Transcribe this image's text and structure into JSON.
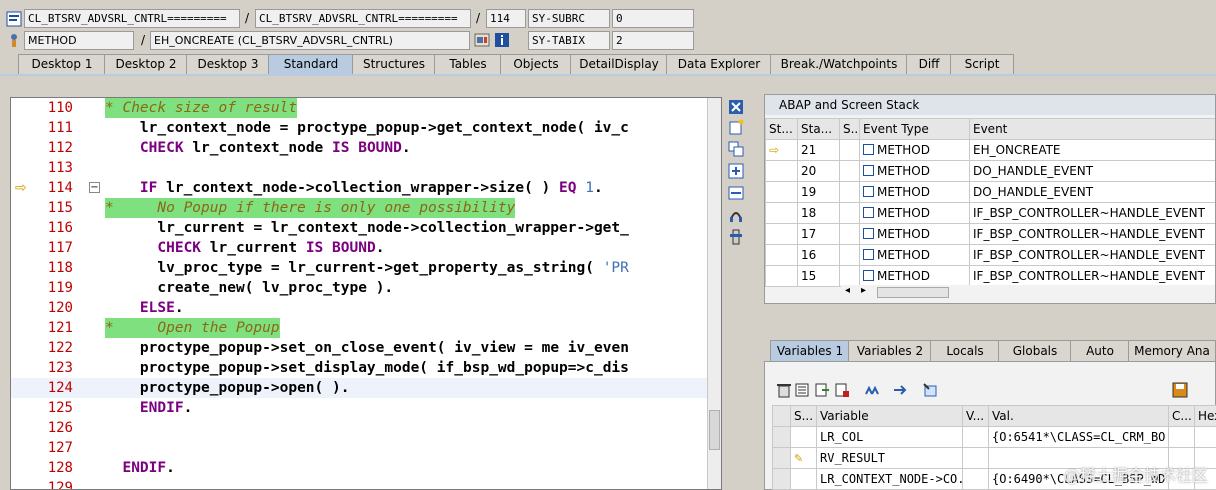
{
  "header": {
    "program1": "CL_BTSRV_ADVSRL_CNTRL=========",
    "program2": "CL_BTSRV_ADVSRL_CNTRL=========",
    "line_no": "114",
    "sy_subrc_label": "SY-SUBRC",
    "sy_subrc_value": "0",
    "kind": "METHOD",
    "event_name": "EH_ONCREATE (CL_BTSRV_ADVSRL_CNTRL)",
    "sy_tabix_label": "SY-TABIX",
    "sy_tabix_value": "2",
    "separator": "/"
  },
  "tabs": [
    "Desktop 1",
    "Desktop 2",
    "Desktop 3",
    "Standard",
    "Structures",
    "Tables",
    "Objects",
    "DetailDisplay",
    "Data Explorer",
    "Break./Watchpoints",
    "Diff",
    "Script"
  ],
  "code": {
    "lines": [
      {
        "n": "110",
        "text": "* Check size of result",
        "comment": true
      },
      {
        "n": "111",
        "text": "    lr_context_node = proctype_popup->get_context_node( iv_c"
      },
      {
        "n": "112",
        "text": "    CHECK lr_context_node IS BOUND."
      },
      {
        "n": "113",
        "text": ""
      },
      {
        "n": "114",
        "text": "    IF lr_context_node->collection_wrapper->size( ) EQ 1."
      },
      {
        "n": "115",
        "text": "*     No Popup if there is only one possibility",
        "comment": true
      },
      {
        "n": "116",
        "text": "      lr_current = lr_context_node->collection_wrapper->get_"
      },
      {
        "n": "117",
        "text": "      CHECK lr_current IS BOUND."
      },
      {
        "n": "118",
        "text": "      lv_proc_type = lr_current->get_property_as_string( 'PR"
      },
      {
        "n": "119",
        "text": "      create_new( lv_proc_type )."
      },
      {
        "n": "120",
        "text": "    ELSE."
      },
      {
        "n": "121",
        "text": "*     Open the Popup",
        "comment": true
      },
      {
        "n": "122",
        "text": "    proctype_popup->set_on_close_event( iv_view = me iv_even"
      },
      {
        "n": "123",
        "text": "    proctype_popup->set_display_mode( if_bsp_wd_popup=>c_dis"
      },
      {
        "n": "124",
        "text": "    proctype_popup->open( )."
      },
      {
        "n": "125",
        "text": "    ENDIF."
      },
      {
        "n": "126",
        "text": ""
      },
      {
        "n": "127",
        "text": ""
      },
      {
        "n": "128",
        "text": "  ENDIF."
      },
      {
        "n": "129",
        "text": ""
      }
    ],
    "current_line": "114"
  },
  "stack": {
    "title": "ABAP and Screen Stack",
    "columns": [
      "St...",
      "Sta...",
      "S...",
      "Event Type",
      "Event"
    ],
    "rows": [
      {
        "sta": "21",
        "type": "METHOD",
        "event": "EH_ONCREATE",
        "current": true
      },
      {
        "sta": "20",
        "type": "METHOD",
        "event": "DO_HANDLE_EVENT"
      },
      {
        "sta": "19",
        "type": "METHOD",
        "event": "DO_HANDLE_EVENT"
      },
      {
        "sta": "18",
        "type": "METHOD",
        "event": "IF_BSP_CONTROLLER~HANDLE_EVENT"
      },
      {
        "sta": "17",
        "type": "METHOD",
        "event": "IF_BSP_CONTROLLER~HANDLE_EVENT"
      },
      {
        "sta": "16",
        "type": "METHOD",
        "event": "IF_BSP_CONTROLLER~HANDLE_EVENT"
      },
      {
        "sta": "15",
        "type": "METHOD",
        "event": "IF_BSP_CONTROLLER~HANDLE_EVENT"
      }
    ]
  },
  "var_tabs": [
    "Variables 1",
    "Variables 2",
    "Locals",
    "Globals",
    "Auto",
    "Memory Ana"
  ],
  "variables": {
    "columns": [
      "S...",
      "Variable",
      "V...",
      "Val.",
      "C...",
      "Hex"
    ],
    "rows": [
      {
        "name": "LR_COL",
        "val": "{O:6541*\\CLASS=CL_CRM_BO..."
      },
      {
        "name": "RV_RESULT",
        "val": ""
      },
      {
        "name": "LR_CONTEXT_NODE->CO...",
        "val": "{O:6490*\\CLASS=CL_BSP_WD..."
      }
    ]
  },
  "watermark": "@稀土掘金技术社区",
  "colors": {
    "comment_bg": "#7fe07f",
    "keyword": "#7a0080",
    "tab_active": "#b8cbe0"
  }
}
